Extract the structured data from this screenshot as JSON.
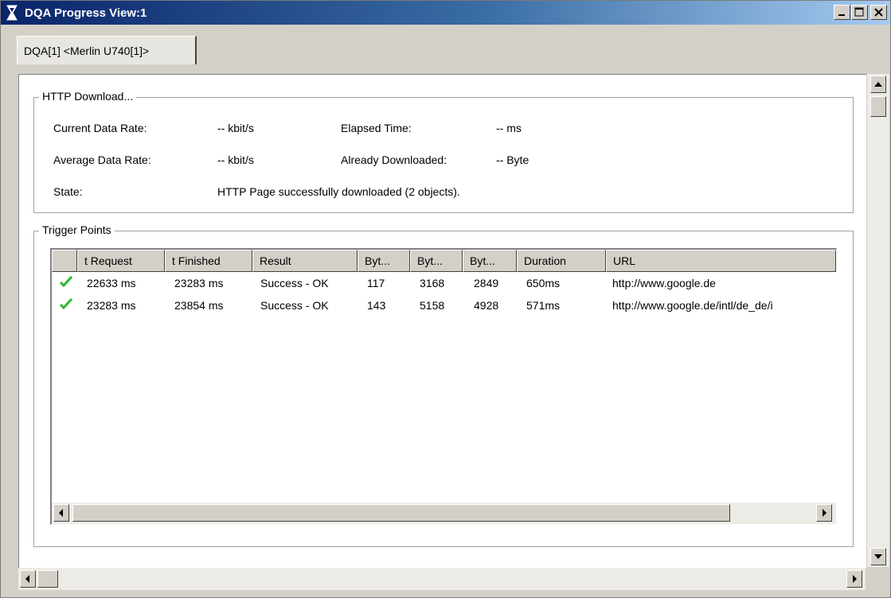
{
  "window": {
    "title": "DQA Progress View:1"
  },
  "tabs": [
    {
      "label": "DQA[1] <Merlin U740[1]>"
    }
  ],
  "http": {
    "title": "HTTP Download...",
    "current_rate_label": "Current Data Rate:",
    "current_rate_value": "-- kbit/s",
    "elapsed_label": "Elapsed Time:",
    "elapsed_value": "-- ms",
    "avg_rate_label": "Average Data Rate:",
    "avg_rate_value": "-- kbit/s",
    "downloaded_label": "Already Downloaded:",
    "downloaded_value": "-- Byte",
    "state_label": "State:",
    "state_value": "HTTP Page successfully downloaded (2 objects)."
  },
  "trigger": {
    "title": "Trigger Points",
    "columns": [
      "",
      "t Request",
      "t Finished",
      "Result",
      "Byt...",
      "Byt...",
      "Byt...",
      "Duration",
      "URL"
    ],
    "rows": [
      {
        "status_icon": "check-icon",
        "t_request": "22633 ms",
        "t_finished": "23283 ms",
        "result": "Success - OK",
        "b1": "117",
        "b2": "3168",
        "b3": "2849",
        "duration": "650ms",
        "url": "http://www.google.de"
      },
      {
        "status_icon": "check-icon",
        "t_request": "23283 ms",
        "t_finished": "23854 ms",
        "result": "Success - OK",
        "b1": "143",
        "b2": "5158",
        "b3": "4928",
        "duration": "571ms",
        "url": "http://www.google.de/intl/de_de/i"
      }
    ]
  },
  "colors": {
    "title_start": "#0a246a",
    "title_end": "#a6caf0",
    "check": "#2eb82e",
    "face": "#d4d0c8"
  }
}
